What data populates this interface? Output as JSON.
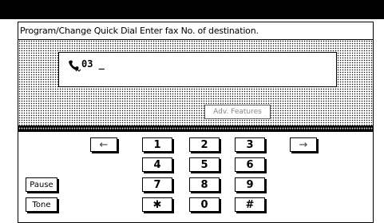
{
  "header": {
    "title": "Program/Change Quick Dial   Enter fax No. of destination."
  },
  "entry": {
    "icon": "quick-dial-phone-icon",
    "value": "03 _"
  },
  "buttons": {
    "adv_features": "Adv. Features",
    "left_arrow": "←",
    "right_arrow": "→",
    "pause": "Pause",
    "tone": "Tone"
  },
  "keypad": [
    "1",
    "2",
    "3",
    "4",
    "5",
    "6",
    "7",
    "8",
    "9",
    "✱",
    "0",
    "#"
  ]
}
